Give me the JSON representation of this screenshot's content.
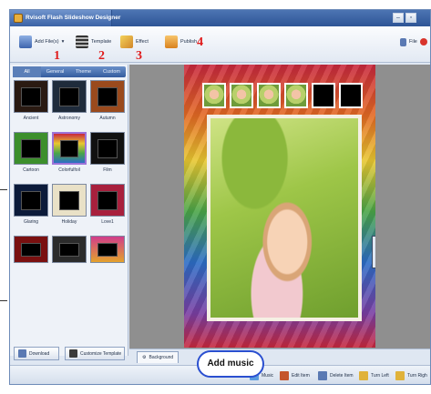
{
  "window": {
    "title": "Rvisoft Flash Slideshow Designer"
  },
  "toolbar": {
    "items": [
      {
        "label": "Add File(s)",
        "number": "1",
        "icon": "add-files-icon",
        "color": "#5c7fbf"
      },
      {
        "label": "Template",
        "number": "2",
        "icon": "template-icon",
        "color": "#3b3b3b"
      },
      {
        "label": "Effect",
        "number": "3",
        "icon": "effect-icon",
        "color": "#e5b02e"
      },
      {
        "label": "Publish",
        "number": "4",
        "icon": "publish-icon",
        "color": "#e69a24"
      }
    ],
    "right_file_label": "File"
  },
  "tabs": [
    "All",
    "General",
    "Theme",
    "Custom"
  ],
  "themes": [
    "Ancient",
    "Astronomy",
    "Autumn",
    "Cartoon",
    "Colorfulfoil",
    "Film",
    "Glaring",
    "Holiday",
    "Love1",
    "",
    "",
    ""
  ],
  "left_buttons": {
    "download": "Download",
    "customize": "Customize Template"
  },
  "bottom": {
    "background_tab": "Background"
  },
  "actions": {
    "music": "Music",
    "edit_item": "Edit Item",
    "delete_item": "Delete Item",
    "turn_left": "Turn Left",
    "turn_right": "Turn Righ"
  },
  "callout": "Add music",
  "colors": {
    "accent": "#e01b1b",
    "callout_border": "#2a4fd0",
    "titlebar": "#3b63a6"
  }
}
